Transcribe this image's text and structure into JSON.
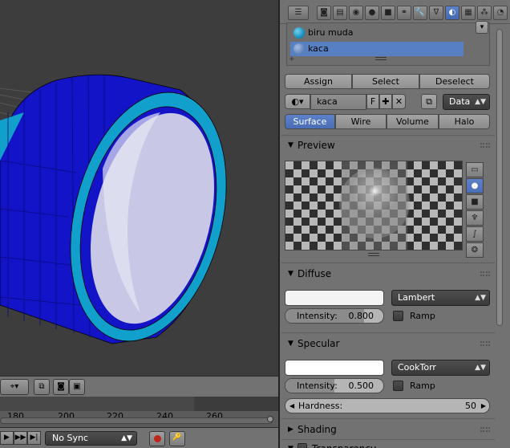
{
  "slots": [
    {
      "name": "biru muda",
      "color": "#1da5d6",
      "selected": false
    },
    {
      "name": "kaca",
      "color": "#5a7fb8",
      "selected": true
    }
  ],
  "slot_actions": {
    "assign": "Assign",
    "select": "Select",
    "deselect": "Deselect"
  },
  "material": {
    "name": "kaca",
    "fake_user": "F",
    "link": "Data"
  },
  "tabs": [
    {
      "label": "Surface",
      "active": true
    },
    {
      "label": "Wire",
      "active": false
    },
    {
      "label": "Volume",
      "active": false
    },
    {
      "label": "Halo",
      "active": false
    }
  ],
  "preview": {
    "title": "Preview"
  },
  "diffuse": {
    "title": "Diffuse",
    "color": "#f4f4f4",
    "shader": "Lambert",
    "intensity_label": "Intensity:",
    "intensity": "0.800",
    "intensity_fraction": 0.8,
    "ramp_label": "Ramp"
  },
  "specular": {
    "title": "Specular",
    "color": "#ffffff",
    "shader": "CookTorr",
    "intensity_label": "Intensity:",
    "intensity": "0.500",
    "intensity_fraction": 0.5,
    "ramp_label": "Ramp",
    "hardness_label": "Hardness:",
    "hardness": "50"
  },
  "shading": {
    "title": "Shading"
  },
  "transparency": {
    "title": "Transparency"
  },
  "timeline": {
    "ticks": [
      "180",
      "200",
      "220",
      "240",
      "260"
    ]
  },
  "playback": {
    "sync": "No Sync"
  },
  "colors": {
    "object_blue": "#1313c8",
    "rim_cyan": "#11a0cc",
    "inner": "#c8c8e6",
    "accent": "#5680c2"
  }
}
